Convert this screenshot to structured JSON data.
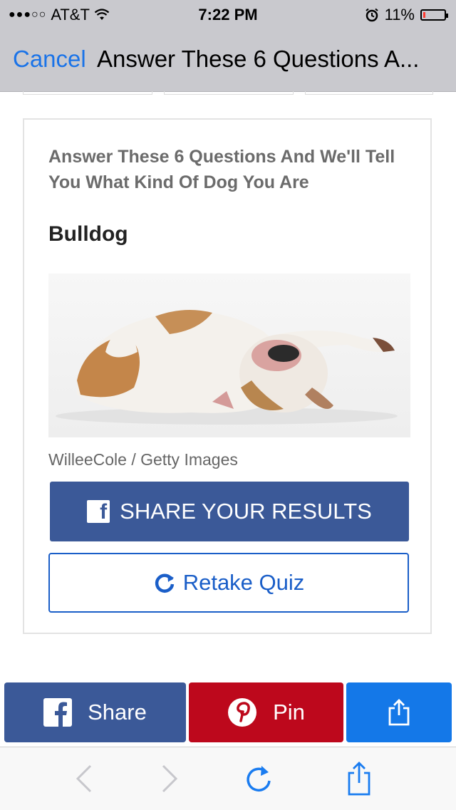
{
  "status_bar": {
    "signal_dots": "●●●○○",
    "carrier": "AT&T",
    "time": "7:22 PM",
    "battery_percent": "11%",
    "battery_level": 0.11,
    "icons": [
      "wifi-icon",
      "alarm-icon",
      "battery-icon"
    ]
  },
  "nav_bar": {
    "cancel_label": "Cancel",
    "title": "Answer These 6 Questions A..."
  },
  "result_card": {
    "quiz_title": "Answer These 6 Questions And We'll Tell You What Kind Of Dog You Are",
    "result_title": "Bulldog",
    "image_credit": "WilleeCole / Getty Images",
    "share_results_label": "SHARE YOUR RESULTS",
    "retake_label": "Retake Quiz"
  },
  "share_bar": {
    "facebook_label": "Share",
    "pinterest_label": "Pin",
    "more_icon": "share-icon"
  },
  "toolbar": {
    "icons": [
      "back-icon",
      "forward-icon",
      "reload-icon",
      "share-icon"
    ]
  },
  "colors": {
    "facebook_blue": "#3b5998",
    "pinterest_red": "#bd081c",
    "share_blue": "#1478e8",
    "link_blue": "#1a73e8",
    "chrome_gray": "#c9c9ce"
  }
}
